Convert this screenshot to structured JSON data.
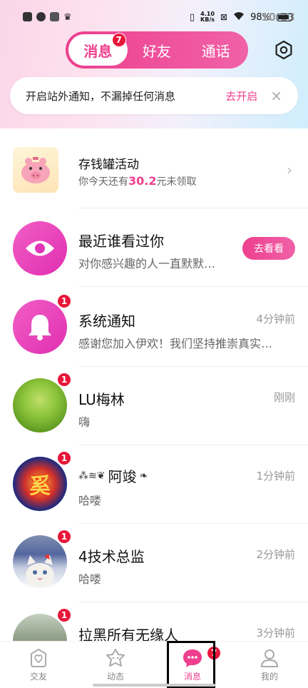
{
  "status_bar": {
    "time": "10:23",
    "net_speed": "4.10",
    "net_unit": "KB/s",
    "battery": "98%"
  },
  "tabs": [
    {
      "label": "消息",
      "badge": "7",
      "active": true
    },
    {
      "label": "好友",
      "active": false
    },
    {
      "label": "通话",
      "active": false
    }
  ],
  "notify": {
    "text": "开启站外通知，不漏掉任何消息",
    "action": "去开启",
    "close": "×"
  },
  "piggy": {
    "title": "存钱罐活动",
    "sub_prefix": "你今天还有",
    "amount": "30.2",
    "sub_suffix": "元未领取"
  },
  "visitors": {
    "title": "最近谁看过你",
    "sub": "对你感兴趣的人一直默默…",
    "action": "去看看"
  },
  "messages": [
    {
      "name": "系统通知",
      "preview": "感谢您加入伊欢！我们坚持推崇真实…",
      "time": "4分钟前",
      "badge": "1"
    },
    {
      "name": "LU梅林",
      "preview": "嗨",
      "time": "刚刚",
      "badge": "1"
    },
    {
      "name": "阿竣",
      "preview": "哈喽",
      "time": "1分钟前",
      "badge": "1"
    },
    {
      "name": "4技术总监",
      "preview": "哈喽",
      "time": "2分钟前",
      "badge": "1"
    },
    {
      "name": "拉黑所有无缘人",
      "preview": "",
      "time": "3分钟前",
      "badge": "1"
    }
  ],
  "tabbar": [
    {
      "label": "交友",
      "icon": "heart-box-icon"
    },
    {
      "label": "动态",
      "icon": "star-face-icon"
    },
    {
      "label": "消息",
      "icon": "chat-bubble-icon",
      "badge": "7",
      "active": true
    },
    {
      "label": "我的",
      "icon": "person-icon"
    }
  ],
  "colors": {
    "accent": "#ee3f8e",
    "badge": "#e8173a"
  }
}
